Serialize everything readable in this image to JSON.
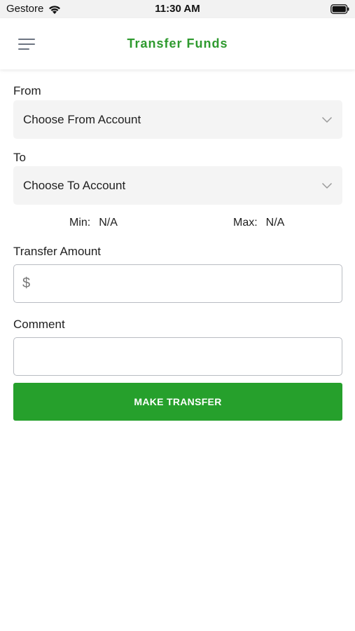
{
  "status_bar": {
    "carrier": "Gestore",
    "time": "11:30 AM",
    "wifi_icon": "wifi-icon",
    "battery_icon": "battery-icon"
  },
  "header": {
    "title": "Transfer Funds",
    "menu_icon": "hamburger-menu-icon",
    "title_color": "#2e9a2e"
  },
  "form": {
    "from": {
      "label": "From",
      "value": "Choose From Account"
    },
    "to": {
      "label": "To",
      "value": "Choose To Account"
    },
    "min": {
      "label": "Min:",
      "value": "N/A"
    },
    "max": {
      "label": "Max:",
      "value": "N/A"
    },
    "amount": {
      "label": "Transfer Amount",
      "prefix": "$",
      "value": ""
    },
    "comment": {
      "label": "Comment",
      "value": ""
    },
    "submit_label": "MAKE TRANSFER",
    "submit_color": "#26a02c"
  }
}
